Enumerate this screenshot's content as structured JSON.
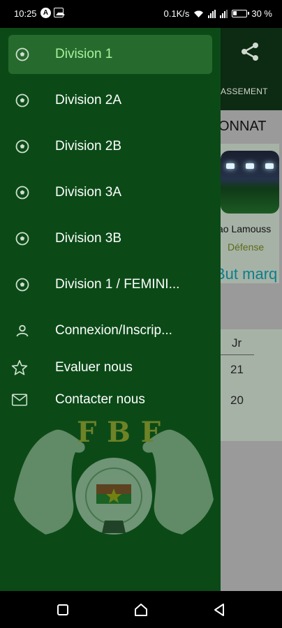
{
  "status_bar": {
    "time": "10:25",
    "notif_icon_a": "A",
    "net_speed": "0.1K/s",
    "battery": "30 %"
  },
  "app": {
    "tab_label": "ASSEMENT",
    "section_title": "ONNAT",
    "card": {
      "name": "ao Lamouss",
      "role": "Défense",
      "stat": "But marq"
    },
    "table": {
      "header": "Jr",
      "rows": [
        "21",
        "20"
      ]
    }
  },
  "drawer": {
    "items": [
      {
        "label": "Division 1",
        "icon": "soccer-ball-icon"
      },
      {
        "label": "Division 2A",
        "icon": "soccer-ball-icon"
      },
      {
        "label": "Division 2B",
        "icon": "soccer-ball-icon"
      },
      {
        "label": "Division 3A",
        "icon": "soccer-ball-icon"
      },
      {
        "label": "Division 3B",
        "icon": "soccer-ball-icon"
      },
      {
        "label": "Division 1 / FEMINI...",
        "icon": "soccer-ball-icon"
      },
      {
        "label": "Connexion/Inscrip...",
        "icon": "person-icon"
      },
      {
        "label": "Evaluer nous",
        "icon": "star-icon"
      },
      {
        "label": "Contacter nous",
        "icon": "mail-icon"
      }
    ],
    "logo_text": "FBF"
  },
  "colors": {
    "drawer_bg": "#0b4a17",
    "active_item_bg": "#276a2e",
    "active_label": "#a9f29a",
    "toolbar_bg": "#0d2a12",
    "accent_teal": "#0b7f8a"
  }
}
